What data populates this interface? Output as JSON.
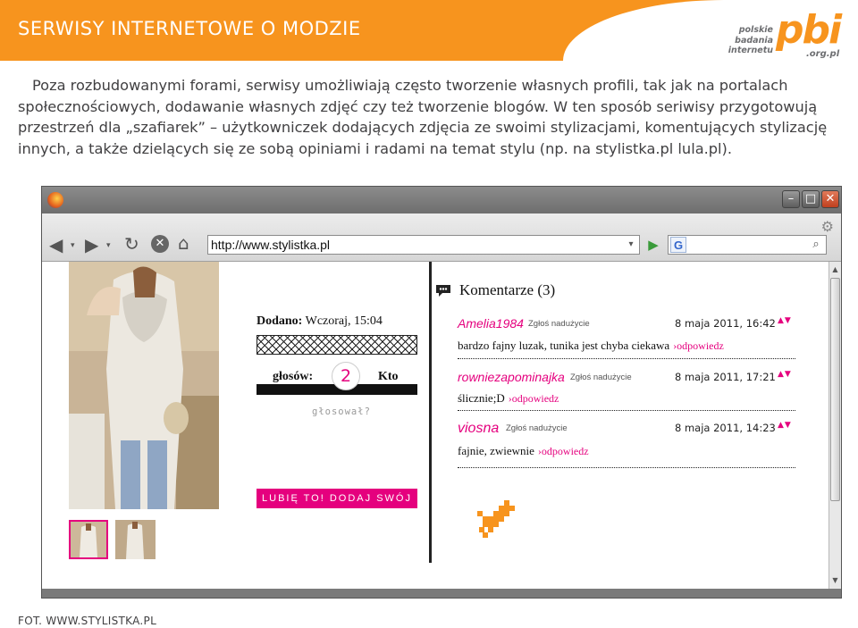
{
  "slide": {
    "title": "SERWISY INTERNETOWE O MODZIE",
    "logo": {
      "small_text": "polskie badania internetu",
      "big_text": "pbi",
      "domain": ".org.pl"
    },
    "paragraph": "Poza rozbudowanymi forami, serwisy umożliwiają często tworzenie własnych profili, tak jak na portalach społecznościowych, dodawanie własnych zdjęć czy też tworzenie blogów. W ten sposób seriwisy przygotowują przestrzeń dla „szafiarek” – użytkowniczek dodających zdjęcia ze swoimi stylizacjami, komentujących stylizację innych, a także dzielących się ze sobą opiniami i radami na temat stylu (np. na stylistka.pl lula.pl).",
    "photo_credit": "FOT. WWW.STYLISTKA.PL",
    "accent_color": "#f7941e"
  },
  "browser": {
    "url": "http://www.stylistka.pl",
    "window_buttons": {
      "minimize": "–",
      "maximize": "□",
      "close": "✕"
    },
    "search_engine_icon": "G",
    "icons": [
      "firefox-icon",
      "back-icon",
      "forward-icon",
      "reload-icon",
      "stop-icon",
      "home-icon",
      "go-icon",
      "search-icon",
      "gear-icon"
    ]
  },
  "page": {
    "added": {
      "label": "Dodano:",
      "value": "Wczoraj, 15:04"
    },
    "votes": {
      "label": "głosów:",
      "count": "2",
      "who": "Kto"
    },
    "voted_question": "głosował?",
    "like_button": "LUBIĘ TO! DODAJ SWÓJ GŁOS",
    "accent_color": "#e5007e",
    "comments_title": "Komentarze (3)",
    "comments": [
      {
        "author": "Amelia1984",
        "report": "Zgłoś nadużycie",
        "date": "8 maja 2011, 16:42",
        "text": "bardzo fajny luzak, tunika jest chyba ciekawa",
        "reply": "›odpowiedz"
      },
      {
        "author": "rowniezapominajka",
        "report": "Zgłoś nadużycie",
        "date": "8 maja 2011, 17:21",
        "text": "ślicznie;D",
        "reply": "›odpowiedz"
      },
      {
        "author": "viosna",
        "report": "Zgłoś nadużycie",
        "date": "8 maja 2011, 14:23",
        "text": "fajnie, zwiewnie",
        "reply": "›odpowiedz"
      }
    ]
  }
}
